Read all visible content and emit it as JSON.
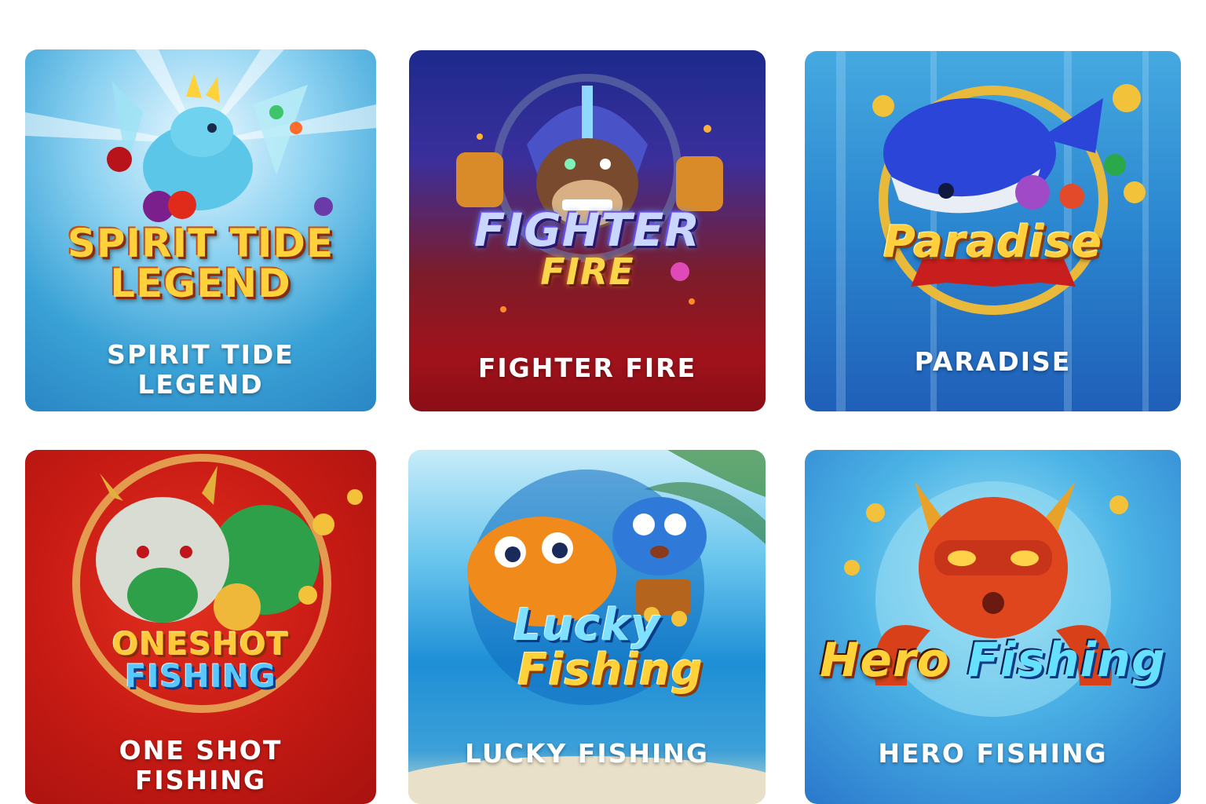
{
  "games": [
    {
      "logo_lines": [
        "SPIRIT TIDE",
        "LEGEND"
      ],
      "title_lines": [
        "SPIRIT TIDE",
        "LEGEND"
      ],
      "accent": "#3aa2d6"
    },
    {
      "logo_lines": [
        "FIGHTER",
        "FIRE"
      ],
      "title_lines": [
        "FIGHTER FIRE"
      ],
      "accent": "#a0121b"
    },
    {
      "logo_lines": [
        "Paradise"
      ],
      "title_lines": [
        "PARADISE"
      ],
      "accent": "#2a85cf"
    },
    {
      "logo_lines": [
        "ONESHOT",
        "FISHING"
      ],
      "title_lines": [
        "ONE SHOT",
        "FISHING"
      ],
      "accent": "#c81b14"
    },
    {
      "logo_lines": [
        "Lucky",
        "Fishing"
      ],
      "title_lines": [
        "LUCKY FISHING"
      ],
      "accent": "#1e8fd6"
    },
    {
      "logo_lines": [
        "Hero",
        "Fishing"
      ],
      "title_lines": [
        "HERO FISHING"
      ],
      "accent": "#2a78cc"
    }
  ],
  "icons": [
    "dragon-icon",
    "gorilla-icon",
    "whale-icon",
    "chinese-dragon-icon",
    "clownfish-icon",
    "octopus-icon"
  ]
}
